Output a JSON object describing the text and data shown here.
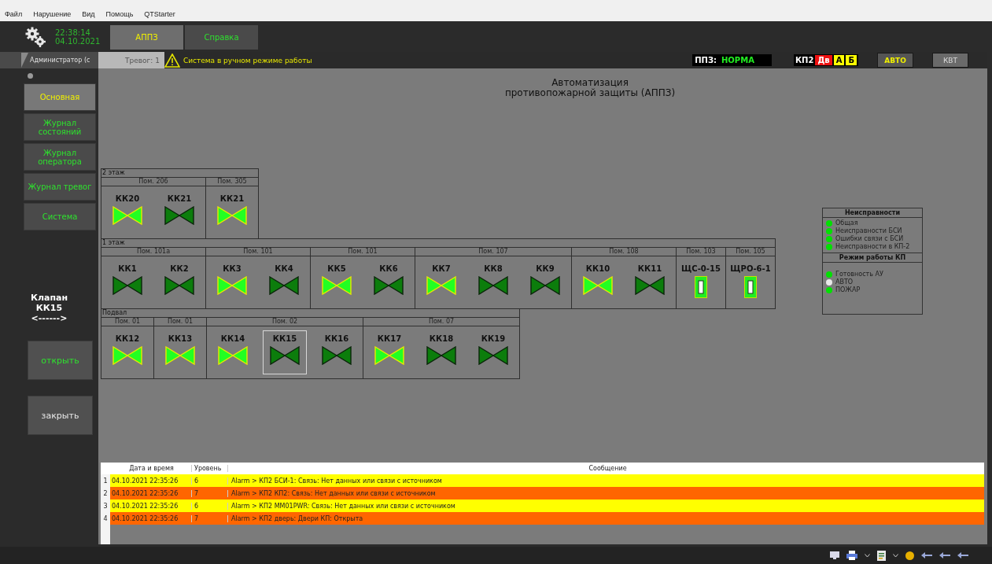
{
  "menu": [
    "Файл",
    "Нарушение",
    "Вид",
    "Помощь",
    "QTStarter"
  ],
  "clock": {
    "time": "22:38:14",
    "date": "04.10.2021"
  },
  "tabs": [
    {
      "label": "АППЗ",
      "selected": true
    },
    {
      "label": "Справка",
      "selected": false
    }
  ],
  "user": "Администратор (с",
  "nav": [
    {
      "label": "Основная",
      "selected": true
    },
    {
      "label": "Журнал состояний",
      "selected": false
    },
    {
      "label": "Журнал оператора",
      "selected": false
    },
    {
      "label": "Журнал тревог",
      "selected": false
    },
    {
      "label": "Система",
      "selected": false
    }
  ],
  "valve_info": [
    "Клапан",
    "КК15",
    "<------>"
  ],
  "actions": [
    {
      "label": "открыть",
      "kind": "open"
    },
    {
      "label": "закрыть",
      "kind": "close"
    }
  ],
  "status": {
    "alarms": "Тревог: 1",
    "message": "Система в ручном режиме работы",
    "ppz_label": "ППЗ:",
    "ppz_value": "НОРМА",
    "kp_label": "КП2",
    "indicators": [
      {
        "label": "Дв",
        "color": "#ee1111"
      },
      {
        "label": "А",
        "color": "#ffff00"
      },
      {
        "label": "Б",
        "color": "#ffff00"
      }
    ],
    "buttons": [
      {
        "label": "АВТО",
        "disabled": false
      },
      {
        "label": "КВТ",
        "disabled": true
      }
    ]
  },
  "title": [
    "Автоматизация",
    "противопожарной защиты (АППЗ)"
  ],
  "floors": [
    {
      "label": "2 этаж",
      "rooms": [
        {
          "label": "Пом. 206",
          "devices": [
            {
              "kind": "valve",
              "label": "КК20",
              "open": true,
              "selected": false
            },
            {
              "kind": "valve",
              "label": "КК21",
              "open": false,
              "selected": false
            }
          ]
        },
        {
          "label": "Пом. 305",
          "devices": [
            {
              "kind": "valve",
              "label": "КК21",
              "open": true,
              "selected": false
            }
          ]
        }
      ]
    },
    {
      "label": "1 этаж",
      "rooms": [
        {
          "label": "Пом. 101а",
          "devices": [
            {
              "kind": "valve",
              "label": "КК1",
              "open": false,
              "selected": false
            },
            {
              "kind": "valve",
              "label": "КК2",
              "open": false,
              "selected": false
            }
          ]
        },
        {
          "label": "Пом. 101",
          "devices": [
            {
              "kind": "valve",
              "label": "КК3",
              "open": true,
              "selected": false
            },
            {
              "kind": "valve",
              "label": "КК4",
              "open": false,
              "selected": false
            }
          ]
        },
        {
          "label": "Пом. 101",
          "devices": [
            {
              "kind": "valve",
              "label": "КК5",
              "open": true,
              "selected": false
            },
            {
              "kind": "valve",
              "label": "КК6",
              "open": false,
              "selected": false
            }
          ]
        },
        {
          "label": "Пом. 107",
          "devices": [
            {
              "kind": "valve",
              "label": "КК7",
              "open": true,
              "selected": false
            },
            {
              "kind": "valve",
              "label": "КК8",
              "open": false,
              "selected": false
            },
            {
              "kind": "valve",
              "label": "КК9",
              "open": false,
              "selected": false
            }
          ]
        },
        {
          "label": "Пом. 108",
          "devices": [
            {
              "kind": "valve",
              "label": "КК10",
              "open": true,
              "selected": false
            },
            {
              "kind": "valve",
              "label": "КК11",
              "open": false,
              "selected": false
            }
          ]
        },
        {
          "label": "Пом. 103",
          "devices": [
            {
              "kind": "cabinet",
              "label": "ЩС-0-15",
              "selected": false
            }
          ]
        },
        {
          "label": "Пом. 105",
          "devices": [
            {
              "kind": "cabinet",
              "label": "ЩРО-6-1",
              "selected": false
            }
          ]
        }
      ]
    },
    {
      "label": "Подвал",
      "rooms": [
        {
          "label": "Пом. 01",
          "devices": [
            {
              "kind": "valve",
              "label": "КК12",
              "open": true,
              "selected": false
            }
          ]
        },
        {
          "label": "Пом. 01",
          "devices": [
            {
              "kind": "valve",
              "label": "КК13",
              "open": true,
              "selected": false
            }
          ]
        },
        {
          "label": "Пом. 02",
          "devices": [
            {
              "kind": "valve",
              "label": "КК14",
              "open": true,
              "selected": false
            },
            {
              "kind": "valve",
              "label": "КК15",
              "open": false,
              "selected": true
            },
            {
              "kind": "valve",
              "label": "КК16",
              "open": false,
              "selected": false
            }
          ]
        },
        {
          "label": "Пом. 07",
          "devices": [
            {
              "kind": "valve",
              "label": "КК17",
              "open": true,
              "selected": false
            },
            {
              "kind": "valve",
              "label": "КК18",
              "open": false,
              "selected": false
            },
            {
              "kind": "valve",
              "label": "КК19",
              "open": false,
              "selected": false
            }
          ]
        }
      ]
    }
  ],
  "legend": [
    {
      "title": "Неисправности",
      "items": [
        {
          "label": "Общая",
          "color": "#00e000"
        },
        {
          "label": "Неисправности БСИ",
          "color": "#00e000"
        },
        {
          "label": "Ошибки связи с БСИ",
          "color": "#00e000"
        },
        {
          "label": "Неисправности в КП-2",
          "color": "#00e000"
        }
      ]
    },
    {
      "title": "Режим работы КП",
      "items": [
        {
          "label": "Готовность АУ",
          "color": "#00e000"
        },
        {
          "label": "АВТО",
          "color": "#e8e8e8"
        },
        {
          "label": "ПОЖАР",
          "color": "#00e000"
        }
      ]
    }
  ],
  "log": {
    "columns": [
      "Дата и время",
      "Уровень",
      "Сообщение"
    ],
    "rows": [
      {
        "n": "1",
        "time": "04.10.2021 22:35:26",
        "level": "6",
        "message": "Alarm > КП2 БСИ-1: Связь: Нет данных или связи с источником",
        "color": "#ffff00"
      },
      {
        "n": "2",
        "time": "04.10.2021 22:35:26",
        "level": "7",
        "message": "Alarm > КП2 КП2: Связь: Нет данных или связи с источником",
        "color": "#ff6600"
      },
      {
        "n": "3",
        "time": "04.10.2021 22:35:26",
        "level": "6",
        "message": "Alarm > КП2 MM01PWR: Связь: Нет данных или связи с источником",
        "color": "#ffff00"
      },
      {
        "n": "4",
        "time": "04.10.2021 22:35:26",
        "level": "7",
        "message": "Alarm > КП2 дверь: Двери КП: Открыта",
        "color": "#ff6600"
      }
    ]
  }
}
